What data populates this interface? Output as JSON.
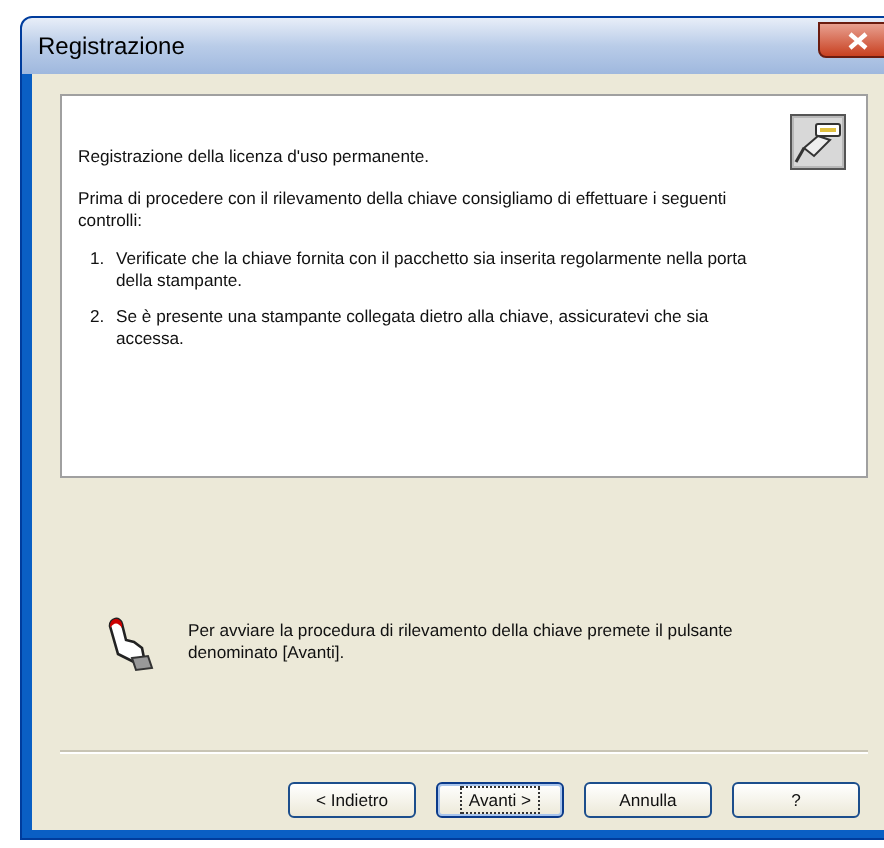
{
  "window": {
    "title": "Registrazione"
  },
  "panel": {
    "heading": "Registrazione della licenza d'uso permanente.",
    "intro": "Prima di procedere con il rilevamento della chiave consigliamo di effettuare i seguenti controlli:",
    "steps": [
      {
        "number": "1.",
        "text": "Verificate che la chiave fornita con il pacchetto sia inserita regolarmente nella porta della stampante."
      },
      {
        "number": "2.",
        "text": "Se è presente una stampante collegata dietro alla chiave, assicuratevi che sia accessa."
      }
    ]
  },
  "hint": "Per avviare la procedura di rilevamento della chiave premete il pulsante denominato [Avanti].",
  "buttons": [
    {
      "label": "< Indietro",
      "focused": false
    },
    {
      "label": "Avanti >",
      "focused": true
    },
    {
      "label": "Annulla",
      "focused": false
    },
    {
      "label": "?",
      "focused": false
    }
  ]
}
